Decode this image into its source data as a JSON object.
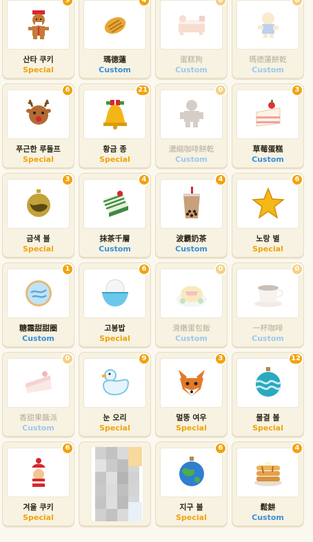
{
  "cards": [
    {
      "name": "산타 쿠키",
      "tier": "Special",
      "count": "9",
      "icon": "gingerbread-santa-icon",
      "faded": false
    },
    {
      "name": "瑪德蓮",
      "tier": "Custom",
      "count": "4",
      "icon": "madeleine-icon",
      "faded": false
    },
    {
      "name": "蛋糕狗",
      "tier": "Custom",
      "count": "0",
      "icon": "cake-dog-icon",
      "faded": true
    },
    {
      "name": "瑪德蓮餅乾",
      "tier": "Custom",
      "count": "0",
      "icon": "madeleine-cookie-icon",
      "faded": true
    },
    {
      "name": "푸근한 루돌프",
      "tier": "Special",
      "count": "6",
      "icon": "reindeer-icon",
      "faded": false
    },
    {
      "name": "황금 종",
      "tier": "Special",
      "count": "21",
      "icon": "golden-bell-icon",
      "faded": false
    },
    {
      "name": "濃縮咖啡餅乾",
      "tier": "Custom",
      "count": "0",
      "icon": "espresso-cookie-icon",
      "faded": true
    },
    {
      "name": "草莓蛋糕",
      "tier": "Custom",
      "count": "3",
      "icon": "strawberry-cake-icon",
      "faded": false
    },
    {
      "name": "금색 볼",
      "tier": "Special",
      "count": "3",
      "icon": "gold-ornament-icon",
      "faded": false
    },
    {
      "name": "抹茶千層",
      "tier": "Custom",
      "count": "4",
      "icon": "matcha-crepe-cake-icon",
      "faded": false
    },
    {
      "name": "波霸奶茶",
      "tier": "Custom",
      "count": "4",
      "icon": "bubble-tea-icon",
      "faded": false
    },
    {
      "name": "노랑 별",
      "tier": "Special",
      "count": "6",
      "icon": "yellow-star-icon",
      "faded": false
    },
    {
      "name": "糖霜甜甜圈",
      "tier": "Custom",
      "count": "1",
      "icon": "frosted-cookie-icon",
      "faded": false
    },
    {
      "name": "고봉밥",
      "tier": "Special",
      "count": "6",
      "icon": "rice-bowl-icon",
      "faded": false
    },
    {
      "name": "滑嫩蛋包飯",
      "tier": "Custom",
      "count": "0",
      "icon": "omelette-rice-icon",
      "faded": true
    },
    {
      "name": "一杯咖啡",
      "tier": "Custom",
      "count": "0",
      "icon": "coffee-cup-icon",
      "faded": true
    },
    {
      "name": "香甜果醬派",
      "tier": "Custom",
      "count": "0",
      "icon": "jam-pie-icon",
      "faded": true
    },
    {
      "name": "눈 오리",
      "tier": "Special",
      "count": "9",
      "icon": "snow-duck-icon",
      "faded": false
    },
    {
      "name": "멀뚱 여우",
      "tier": "Special",
      "count": "3",
      "icon": "fox-icon",
      "faded": false
    },
    {
      "name": "물결 볼",
      "tier": "Special",
      "count": "12",
      "icon": "wave-ornament-icon",
      "faded": false
    },
    {
      "name": "겨울 쿠키",
      "tier": "Special",
      "count": "6",
      "icon": "winter-cookie-icon",
      "faded": false
    },
    {
      "name": "",
      "tier": "",
      "count": "",
      "icon": "blurred-image-icon",
      "faded": false,
      "blurred": true
    },
    {
      "name": "지구 볼",
      "tier": "Special",
      "count": "6",
      "icon": "earth-ornament-icon",
      "faded": false
    },
    {
      "name": "鬆餅",
      "tier": "Custom",
      "count": "4",
      "icon": "pancake-stack-icon",
      "faded": false
    }
  ],
  "colors": {
    "special": "#f2a30b",
    "custom": "#3a8fd8",
    "badge": "#f2a30b",
    "card_bg": "#f7f2e1"
  }
}
